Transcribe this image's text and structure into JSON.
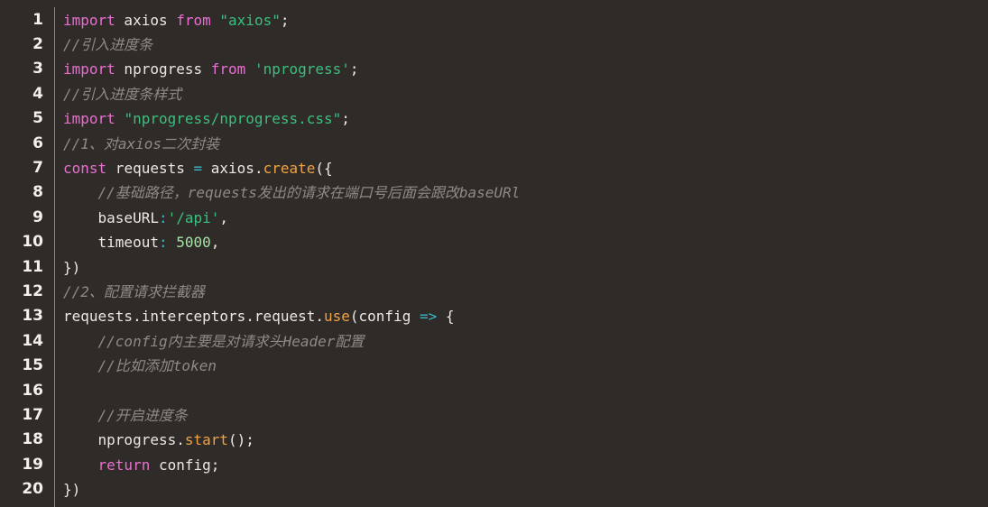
{
  "editor": {
    "background": "#2f2b29",
    "colors": {
      "keyword": "#e86fd0",
      "string": "#3cbf7e",
      "comment": "#8e8a86",
      "function": "#f1a243",
      "number": "#a6e2a6",
      "operator": "#38b8c8",
      "plain": "#ece8e1"
    },
    "lines": [
      {
        "number": "1",
        "tokens": [
          {
            "t": "kw",
            "v": "import"
          },
          {
            "t": "pl",
            "v": " axios "
          },
          {
            "t": "kw",
            "v": "from"
          },
          {
            "t": "pl",
            "v": " "
          },
          {
            "t": "str",
            "v": "\"axios\""
          },
          {
            "t": "pl",
            "v": ";"
          }
        ]
      },
      {
        "number": "2",
        "tokens": [
          {
            "t": "cm",
            "v": "//引入进度条"
          }
        ]
      },
      {
        "number": "3",
        "tokens": [
          {
            "t": "kw",
            "v": "import"
          },
          {
            "t": "pl",
            "v": " nprogress "
          },
          {
            "t": "kw",
            "v": "from"
          },
          {
            "t": "pl",
            "v": " "
          },
          {
            "t": "str",
            "v": "'nprogress'"
          },
          {
            "t": "pl",
            "v": ";"
          }
        ]
      },
      {
        "number": "4",
        "tokens": [
          {
            "t": "cm",
            "v": "//引入进度条样式"
          }
        ]
      },
      {
        "number": "5",
        "tokens": [
          {
            "t": "kw",
            "v": "import"
          },
          {
            "t": "pl",
            "v": " "
          },
          {
            "t": "str",
            "v": "\"nprogress/nprogress.css\""
          },
          {
            "t": "pl",
            "v": ";"
          }
        ]
      },
      {
        "number": "6",
        "tokens": [
          {
            "t": "cm",
            "v": "//1、对axios二次封装"
          }
        ]
      },
      {
        "number": "7",
        "tokens": [
          {
            "t": "kw",
            "v": "const"
          },
          {
            "t": "pl",
            "v": " requests "
          },
          {
            "t": "op",
            "v": "="
          },
          {
            "t": "pl",
            "v": " axios."
          },
          {
            "t": "fn",
            "v": "create"
          },
          {
            "t": "pl",
            "v": "({"
          }
        ]
      },
      {
        "number": "8",
        "tokens": [
          {
            "t": "pl",
            "v": "    "
          },
          {
            "t": "cm",
            "v": "//基础路径，requests发出的请求在端口号后面会跟改baseURl"
          }
        ]
      },
      {
        "number": "9",
        "tokens": [
          {
            "t": "pl",
            "v": "    baseURL"
          },
          {
            "t": "op",
            "v": ":"
          },
          {
            "t": "str",
            "v": "'/api'"
          },
          {
            "t": "pl",
            "v": ","
          }
        ]
      },
      {
        "number": "10",
        "tokens": [
          {
            "t": "pl",
            "v": "    timeout"
          },
          {
            "t": "op",
            "v": ":"
          },
          {
            "t": "pl",
            "v": " "
          },
          {
            "t": "num",
            "v": "5000"
          },
          {
            "t": "pl",
            "v": ","
          }
        ]
      },
      {
        "number": "11",
        "tokens": [
          {
            "t": "pl",
            "v": "})"
          }
        ]
      },
      {
        "number": "12",
        "tokens": [
          {
            "t": "cm",
            "v": "//2、配置请求拦截器"
          }
        ]
      },
      {
        "number": "13",
        "tokens": [
          {
            "t": "pl",
            "v": "requests.interceptors.request."
          },
          {
            "t": "fn",
            "v": "use"
          },
          {
            "t": "pl",
            "v": "(config "
          },
          {
            "t": "op",
            "v": "=>"
          },
          {
            "t": "pl",
            "v": " {"
          }
        ]
      },
      {
        "number": "14",
        "tokens": [
          {
            "t": "pl",
            "v": "    "
          },
          {
            "t": "cm",
            "v": "//config内主要是对请求头Header配置"
          }
        ]
      },
      {
        "number": "15",
        "tokens": [
          {
            "t": "pl",
            "v": "    "
          },
          {
            "t": "cm",
            "v": "//比如添加token"
          }
        ]
      },
      {
        "number": "16",
        "tokens": []
      },
      {
        "number": "17",
        "tokens": [
          {
            "t": "pl",
            "v": "    "
          },
          {
            "t": "cm",
            "v": "//开启进度条"
          }
        ]
      },
      {
        "number": "18",
        "tokens": [
          {
            "t": "pl",
            "v": "    nprogress."
          },
          {
            "t": "fn",
            "v": "start"
          },
          {
            "t": "pl",
            "v": "();"
          }
        ]
      },
      {
        "number": "19",
        "tokens": [
          {
            "t": "pl",
            "v": "    "
          },
          {
            "t": "kw",
            "v": "return"
          },
          {
            "t": "pl",
            "v": " config;"
          }
        ]
      },
      {
        "number": "20",
        "tokens": [
          {
            "t": "pl",
            "v": "})"
          }
        ]
      }
    ]
  }
}
